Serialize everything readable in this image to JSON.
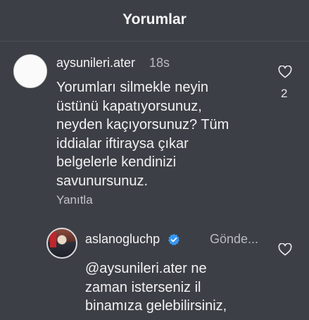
{
  "header": {
    "title": "Yorumlar"
  },
  "comment": {
    "username": "aysunileri.ater",
    "time": "18s",
    "lines": [
      "Yorumları silmekle neyin",
      "üstünü kapatıyorsunuz,",
      "neyden kaçıyorsunuz? Tüm",
      "iddialar iftiraysa çıkar",
      "belgelerle kendinizi",
      "savunursunuz."
    ],
    "reply_label": "Yanıtla",
    "like_count": "2"
  },
  "reply": {
    "username": "aslanogluchp",
    "status": "Gönde...",
    "lines": [
      "@aysunileri.ater ne",
      "zaman isterseniz il",
      "binamıza gelebilirsiniz,"
    ]
  },
  "icons": {
    "like": "heart-outline-icon",
    "verified": "verified-badge-icon"
  },
  "colors": {
    "background": "#3d3f46",
    "verified": "#3897f0",
    "text": "#f2f2f4"
  }
}
